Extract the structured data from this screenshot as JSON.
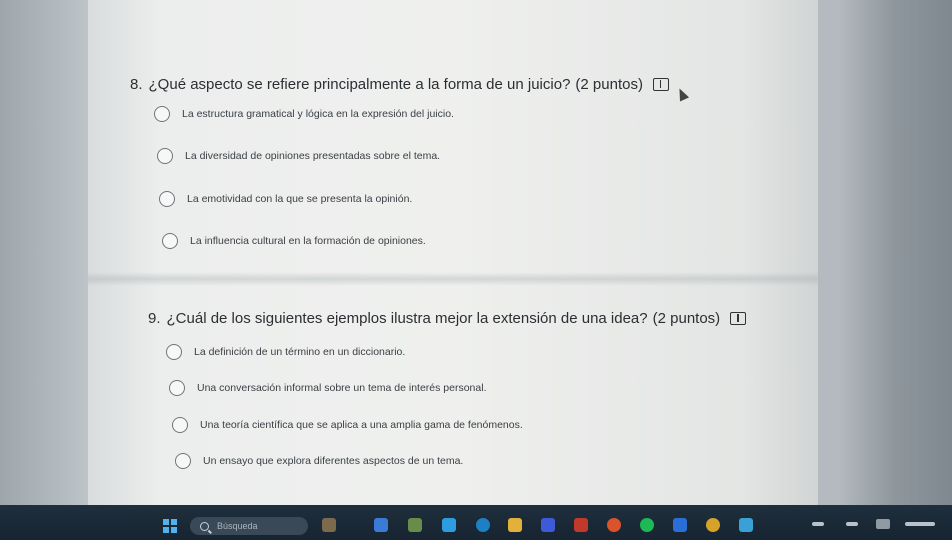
{
  "questions": [
    {
      "number": "8.",
      "text": "¿Qué aspecto se refiere principalmente a la forma de un juicio?",
      "points": "(2 puntos)",
      "options": [
        "La estructura gramatical y lógica en la expresión del juicio.",
        "La diversidad de opiniones presentadas sobre el tema.",
        "La emotividad con la que se presenta la opinión.",
        "La influencia cultural en la formación de opiniones."
      ]
    },
    {
      "number": "9.",
      "text": "¿Cuál de los siguientes ejemplos ilustra mejor la extensión de una idea?",
      "points": "(2 puntos)",
      "options": [
        "La definición de un término en un diccionario.",
        "Una conversación informal sobre un tema de interés personal.",
        "Una teoría científica que se aplica a una amplia gama de fenómenos.",
        "Un ensayo que explora diferentes aspectos de un tema."
      ]
    }
  ],
  "taskbar": {
    "search_placeholder": "Búsqueda",
    "start_icon": "windows-start-icon",
    "search_icon": "search-icon",
    "tray_time": "",
    "accent": "#4fb3ee"
  },
  "icons": {
    "immersive_reader": "immersive-reader-icon",
    "cursor": "mouse-cursor-icon"
  },
  "colors": {
    "card_background": "#eff0ee",
    "text": "#2b2f33",
    "taskbar": "#1f2f3d"
  }
}
